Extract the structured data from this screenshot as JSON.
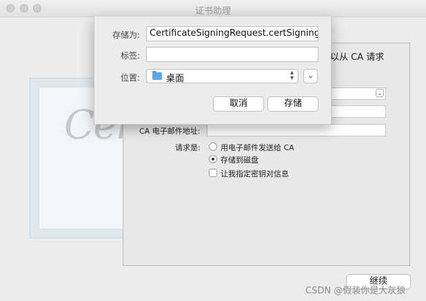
{
  "window": {
    "title": "证书助理"
  },
  "panel": {
    "heading": "以从 CA 请求",
    "ca_email_label": "CA 电子邮件地址:",
    "request_label": "请求是:",
    "options": {
      "email_ca": "用电子邮件发送给 CA",
      "save_disk": "存储到磁盘",
      "specify_key": "让我指定密钥对信息"
    },
    "continue_label": "继续"
  },
  "save_sheet": {
    "save_as_label": "存储为:",
    "save_as_value": "CertificateSigningRequest.certSigningRequest",
    "tags_label": "标签:",
    "tags_value": "",
    "location_label": "位置:",
    "location_value": "桌面",
    "cancel_label": "取消",
    "save_label": "存储"
  },
  "watermark": "CSDN @假装你是大灰狼",
  "background_art": {
    "script_text": "Certi"
  }
}
